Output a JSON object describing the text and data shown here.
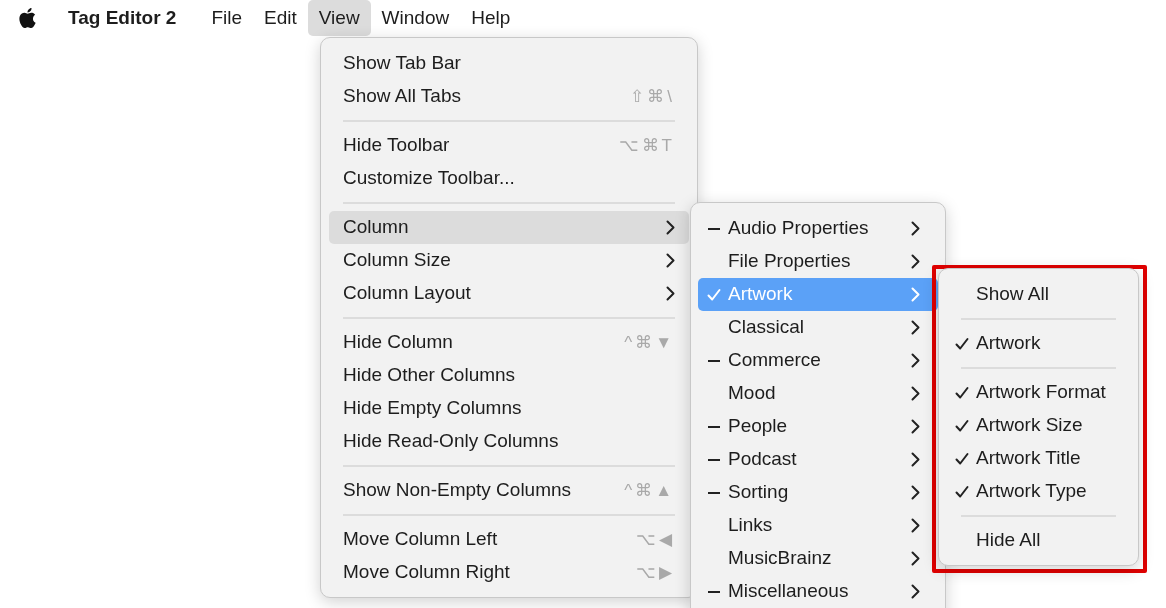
{
  "menu_bar": {
    "app_name": "Tag Editor 2",
    "menus": [
      {
        "label": "File",
        "selected": false
      },
      {
        "label": "Edit",
        "selected": false
      },
      {
        "label": "View",
        "selected": true
      },
      {
        "label": "Window",
        "selected": false
      },
      {
        "label": "Help",
        "selected": false
      }
    ]
  },
  "view_menu": {
    "groups": [
      [
        {
          "label": "Show Tab Bar"
        },
        {
          "label": "Show All Tabs",
          "shortcut": "⇧⌘\\"
        }
      ],
      [
        {
          "label": "Hide Toolbar",
          "shortcut": "⌥⌘T"
        },
        {
          "label": "Customize Toolbar..."
        }
      ],
      [
        {
          "label": "Column",
          "submenu": true,
          "selected": true
        },
        {
          "label": "Column Size",
          "submenu": true,
          "selected": false
        },
        {
          "label": "Column Layout",
          "submenu": true,
          "selected": false
        }
      ],
      [
        {
          "label": "Hide Column",
          "shortcut": "^⌘▼"
        },
        {
          "label": "Hide Other Columns"
        },
        {
          "label": "Hide Empty Columns"
        },
        {
          "label": "Hide Read-Only Columns"
        }
      ],
      [
        {
          "label": "Show Non-Empty Columns",
          "shortcut": "^⌘▲"
        }
      ],
      [
        {
          "label": "Move Column Left",
          "shortcut": "⌥◀"
        },
        {
          "label": "Move Column Right",
          "shortcut": "⌥▶"
        }
      ]
    ]
  },
  "column_submenu": {
    "items": [
      {
        "label": "Audio Properties",
        "checked": false,
        "partial": true,
        "selected": false
      },
      {
        "label": "File Properties",
        "checked": false,
        "partial": false,
        "selected": false
      },
      {
        "label": "Artwork",
        "checked": true,
        "partial": false,
        "selected": true
      },
      {
        "label": "Classical",
        "checked": false,
        "partial": false,
        "selected": false
      },
      {
        "label": "Commerce",
        "checked": false,
        "partial": true,
        "selected": false
      },
      {
        "label": "Mood",
        "checked": false,
        "partial": false,
        "selected": false
      },
      {
        "label": "People",
        "checked": false,
        "partial": true,
        "selected": false
      },
      {
        "label": "Podcast",
        "checked": false,
        "partial": true,
        "selected": false
      },
      {
        "label": "Sorting",
        "checked": false,
        "partial": true,
        "selected": false
      },
      {
        "label": "Links",
        "checked": false,
        "partial": false,
        "selected": false
      },
      {
        "label": "MusicBrainz",
        "checked": false,
        "partial": false,
        "selected": false
      },
      {
        "label": "Miscellaneous",
        "checked": false,
        "partial": true,
        "selected": false
      }
    ]
  },
  "artwork_submenu": {
    "highlighted": true,
    "groups": [
      [
        {
          "label": "Show All",
          "checked": false
        }
      ],
      [
        {
          "label": "Artwork",
          "checked": true
        }
      ],
      [
        {
          "label": "Artwork Format",
          "checked": true
        },
        {
          "label": "Artwork Size",
          "checked": true
        },
        {
          "label": "Artwork Title",
          "checked": true
        },
        {
          "label": "Artwork Type",
          "checked": true
        }
      ],
      [
        {
          "label": "Hide All",
          "checked": false
        }
      ]
    ]
  }
}
